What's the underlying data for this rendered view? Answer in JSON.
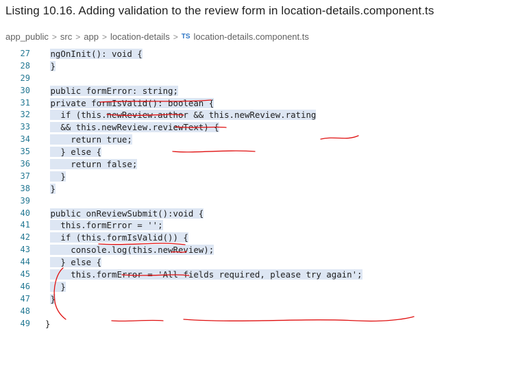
{
  "caption": "Listing 10.16. Adding validation to the review form in location-details.component.ts",
  "breadcrumb": {
    "items": [
      "app_public",
      "src",
      "app",
      "location-details"
    ],
    "file_badge": "TS",
    "file": "location-details.component.ts",
    "separator": ">"
  },
  "editor": {
    "line_numbers": [
      "27",
      "28",
      "29",
      "30",
      "31",
      "32",
      "33",
      "34",
      "35",
      "36",
      "37",
      "38",
      "39",
      "40",
      "41",
      "42",
      "43",
      "44",
      "45",
      "46",
      "47",
      "48",
      "49"
    ],
    "code_lines": [
      "ngOnInit(): void {",
      "}",
      "",
      "public formError: string;",
      "private formIsValid(): boolean {",
      "  if (this.newReview.author && this.newReview.rating",
      "  && this.newReview.reviewText) {",
      "    return true;",
      "  } else {",
      "    return false;",
      "  }",
      "}",
      "",
      "public onReviewSubmit():void {",
      "  this.formError = '';",
      "  if (this.formIsValid()) {",
      "    console.log(this.newReview);",
      "  } else {",
      "    this.formError = 'All fields required, please try again';",
      "  }",
      "}",
      "",
      "}"
    ]
  },
  "colors": {
    "keyword": "#0000ff",
    "type": "#267f99",
    "string": "#a31515",
    "function": "#795e26",
    "line_number": "#237893",
    "selection": "#dde6f3",
    "annotation": "#e01010"
  }
}
